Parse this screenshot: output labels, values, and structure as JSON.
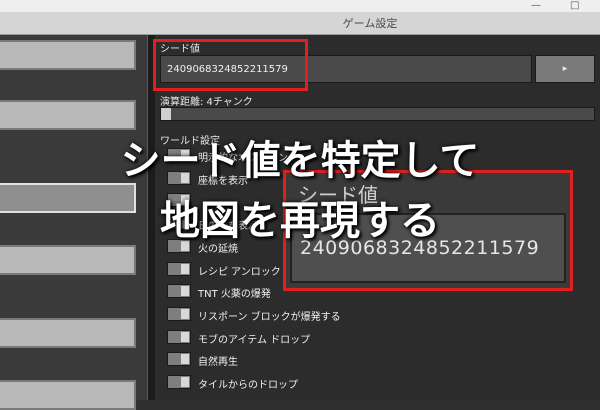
{
  "window": {
    "title": "ゲーム設定",
    "controls": [
      "—",
      "□"
    ]
  },
  "seed": {
    "label": "シード値",
    "value": "2409068324852211579",
    "button_icon": "play-triangle-icon",
    "button_glyph": "▸"
  },
  "render_distance": {
    "label": "演算距離: 4チャンク",
    "fraction": 0.0
  },
  "world_section": {
    "label": "ワールド設定"
  },
  "options": [
    {
      "label": "明示的なオプション",
      "on": true
    },
    {
      "label": "座標を表示",
      "on": true
    },
    {
      "label": "",
      "on": true
    },
    {
      "label": "日の光を表示",
      "on": true
    },
    {
      "label": "火の延焼",
      "on": true
    },
    {
      "label": "レシピ アンロック",
      "on": true
    },
    {
      "label": "TNT 火薬の爆発",
      "on": true
    },
    {
      "label": "リスポーン ブロックが爆発する",
      "on": true
    },
    {
      "label": "モブのアイテム ドロップ",
      "on": true
    },
    {
      "label": "自然再生",
      "on": true
    },
    {
      "label": "タイルからのドロップ",
      "on": true
    }
  ],
  "overlay": {
    "line1": "シード値を特定して",
    "line2": "地図を再現する"
  },
  "zoom_callout": {
    "label": "シード値",
    "value": "2409068324852211579"
  },
  "colors": {
    "highlight": "#e02020",
    "panel": "#2c2c2c"
  }
}
